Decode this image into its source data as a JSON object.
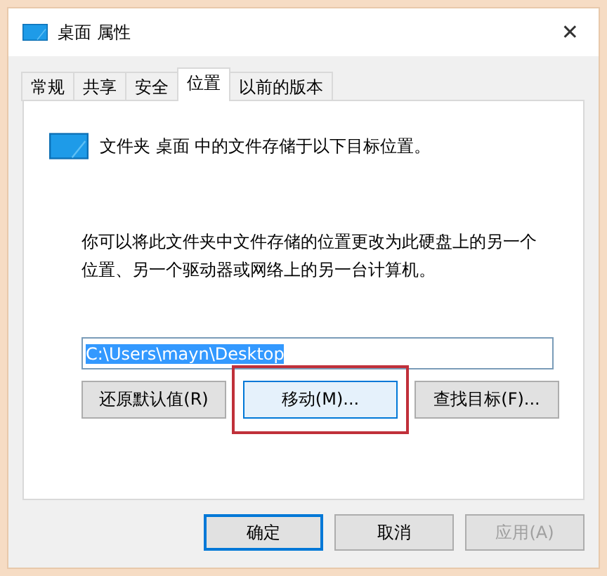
{
  "window": {
    "title": "桌面 属性",
    "close": "✕"
  },
  "tabs": [
    {
      "label": "常规",
      "selected": false
    },
    {
      "label": "共享",
      "selected": false
    },
    {
      "label": "安全",
      "selected": false
    },
    {
      "label": "位置",
      "selected": true
    },
    {
      "label": "以前的版本",
      "selected": false
    }
  ],
  "header": "文件夹 桌面 中的文件存储于以下目标位置。",
  "description": "你可以将此文件夹中文件存储的位置更改为此硬盘上的另一个位置、另一个驱动器或网络上的另一台计算机。",
  "path_field": {
    "value": "C:\\Users\\mayn\\Desktop",
    "selected": true
  },
  "actions": [
    {
      "label": "还原默认值(R)",
      "highlighted": false
    },
    {
      "label": "移动(M)...",
      "highlighted": true
    },
    {
      "label": "查找目标(F)...",
      "highlighted": false
    }
  ],
  "footer_buttons": [
    {
      "label": "确定",
      "default": true,
      "disabled": false
    },
    {
      "label": "取消",
      "default": false,
      "disabled": false
    },
    {
      "label": "应用(A)",
      "default": false,
      "disabled": true
    }
  ]
}
